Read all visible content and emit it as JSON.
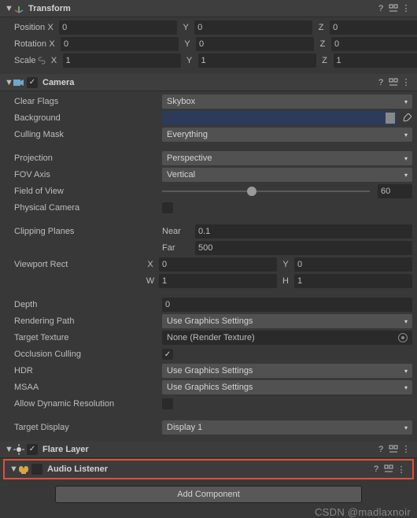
{
  "transform": {
    "title": "Transform",
    "position": {
      "label": "Position",
      "x": "0",
      "y": "0",
      "z": "0"
    },
    "rotation": {
      "label": "Rotation",
      "x": "0",
      "y": "0",
      "z": "0"
    },
    "scale": {
      "label": "Scale",
      "x": "1",
      "y": "1",
      "z": "1"
    },
    "axis": {
      "x": "X",
      "y": "Y",
      "z": "Z"
    }
  },
  "camera": {
    "title": "Camera",
    "clear_flags": {
      "label": "Clear Flags",
      "value": "Skybox"
    },
    "background": {
      "label": "Background"
    },
    "culling_mask": {
      "label": "Culling Mask",
      "value": "Everything"
    },
    "projection": {
      "label": "Projection",
      "value": "Perspective"
    },
    "fov_axis": {
      "label": "FOV Axis",
      "value": "Vertical"
    },
    "field_of_view": {
      "label": "Field of View",
      "value": "60"
    },
    "physical_camera": {
      "label": "Physical Camera",
      "value": false
    },
    "clipping_planes": {
      "label": "Clipping Planes",
      "near_label": "Near",
      "near": "0.1",
      "far_label": "Far",
      "far": "500"
    },
    "viewport_rect": {
      "label": "Viewport Rect",
      "x_label": "X",
      "x": "0",
      "y_label": "Y",
      "y": "0",
      "w_label": "W",
      "w": "1",
      "h_label": "H",
      "h": "1"
    },
    "depth": {
      "label": "Depth",
      "value": "0"
    },
    "rendering_path": {
      "label": "Rendering Path",
      "value": "Use Graphics Settings"
    },
    "target_texture": {
      "label": "Target Texture",
      "value": "None (Render Texture)"
    },
    "occlusion_culling": {
      "label": "Occlusion Culling",
      "value": true
    },
    "hdr": {
      "label": "HDR",
      "value": "Use Graphics Settings"
    },
    "msaa": {
      "label": "MSAA",
      "value": "Use Graphics Settings"
    },
    "allow_dynamic_res": {
      "label": "Allow Dynamic Resolution",
      "value": false
    },
    "target_display": {
      "label": "Target Display",
      "value": "Display 1"
    }
  },
  "flare_layer": {
    "title": "Flare Layer",
    "enabled": true
  },
  "audio_listener": {
    "title": "Audio Listener",
    "enabled": false
  },
  "add_component": "Add Component",
  "watermark": "CSDN @madlaxnoir"
}
